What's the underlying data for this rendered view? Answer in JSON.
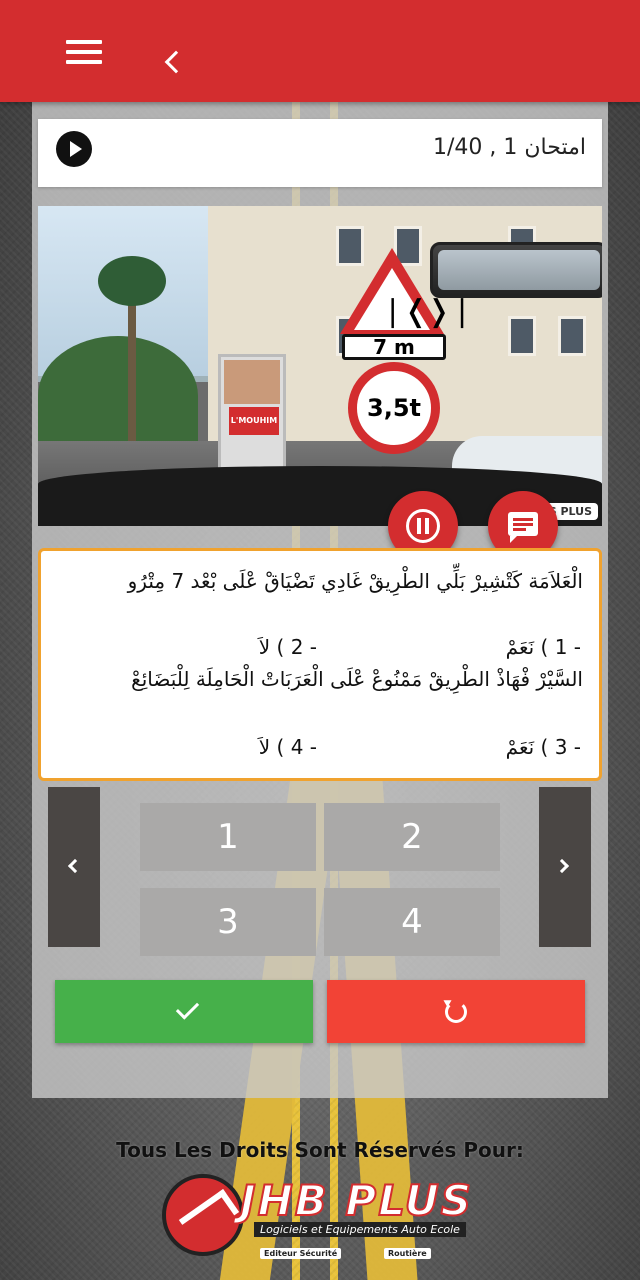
{
  "colors": {
    "primary": "#d32d2f",
    "accent_border": "#f0a22e",
    "success": "#46b04a",
    "danger": "#f24336",
    "nav_dark": "#4a4644",
    "answer_gray": "#aaa9a8"
  },
  "toolbar": {
    "menu_icon": "hamburger-menu-icon",
    "back_icon": "chevron-left-icon"
  },
  "exam": {
    "title": "امتحان 1 , 1/40",
    "play_icon": "play-circle-icon"
  },
  "photo": {
    "sign_distance": "7 m",
    "sign_weight": "3,5t",
    "billboard_text": "L'MOUHIM",
    "watermark": "CODES PLUS"
  },
  "media_controls": {
    "pause_icon": "pause-circle-icon",
    "comment_icon": "chat-message-icon"
  },
  "question": {
    "statement_1": "الْعَلاَمَة كَتْشِيرْ بَلِّي الطْرِيقْ غَادِي تَضْيَاقْ عْلَى بْعْد 7 مِتْرُو",
    "answer_1": "- 1 ) نَعَمْ",
    "answer_2": "- 2 ) لاَ",
    "statement_2": "السَّيْرْ فْهَاذْ الطْرِيقْ مَمْنُوعْ عْلَى الْعَرَبَاتْ الْحَامِلَة لِلْبَضَائِعْ",
    "answer_3": "- 3 ) نَعَمْ",
    "answer_4": "- 4 ) لاَ"
  },
  "answer_buttons": [
    "1",
    "2",
    "3",
    "4"
  ],
  "navigation": {
    "prev_icon": "chevron-left-icon",
    "next_icon": "chevron-right-icon"
  },
  "actions": {
    "confirm_icon": "checkmark-icon",
    "reset_icon": "refresh-icon"
  },
  "footer": {
    "rights": "Tous Les Droits Sont Réservés Pour:",
    "brand": "JHB PLUS",
    "brand_sub": "Logiciels et Equipements Auto Ecole",
    "brand_tag_left": "Editeur Sécurité",
    "brand_tag_right": "Routière"
  }
}
